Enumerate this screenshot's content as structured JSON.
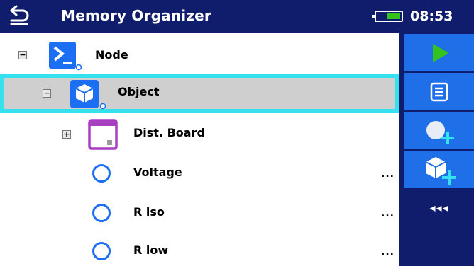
{
  "header": {
    "title": "Memory Organizer",
    "time": "08:53",
    "back_icon": "back-arrow-icon",
    "battery_level": 0.55
  },
  "tree": {
    "rows": [
      {
        "label": "Node",
        "toggle": "−",
        "icon": "node-terminal-icon"
      },
      {
        "label": "Object",
        "toggle": "−",
        "icon": "object-cube-icon",
        "selected": true
      },
      {
        "label": "Dist. Board",
        "toggle": "+",
        "icon": "dist-board-icon"
      },
      {
        "label": "Voltage",
        "icon": "measurement-circle-icon",
        "more": "..."
      },
      {
        "label": "R iso",
        "icon": "measurement-circle-icon",
        "more": "..."
      },
      {
        "label": "R low",
        "icon": "measurement-circle-icon",
        "more": "..."
      }
    ]
  },
  "toolbar": {
    "buttons": [
      {
        "name": "start-test",
        "icon": "play-icon"
      },
      {
        "name": "view-list",
        "icon": "list-icon"
      },
      {
        "name": "add-node",
        "icon": "add-node-icon"
      },
      {
        "name": "add-object",
        "icon": "add-object-icon"
      }
    ],
    "more_label": "◂◂◂"
  },
  "colors": {
    "header_bg": "#101d6c",
    "toolbar_button": "#1f6fe8",
    "selection_outline": "#35e0ef",
    "selection_bg": "#cfcfcf",
    "play_green": "#34c21e",
    "measurement_blue": "#1c6ff2",
    "dist_board_purple": "#a83ec0"
  }
}
